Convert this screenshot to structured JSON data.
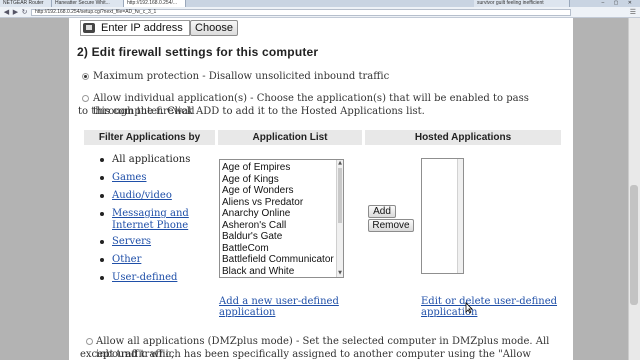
{
  "browser": {
    "tabs": [
      "NETGEAR Router",
      "Haneatter Secure Whit...",
      "http://192.168.0.254/...",
      "survivor guilt feeling inefficient"
    ],
    "window_controls": "– ▢ ✕",
    "url": "http://192.168.0.254/setup.cgi?next_file=AD_fw_c_3_1",
    "nav": {
      "back": "◀",
      "forward": "▶",
      "reload": "↻"
    },
    "menu_icon": "☰"
  },
  "ip": {
    "placeholder": "Enter IP address",
    "choose_label": "Choose"
  },
  "section": {
    "title": "2) Edit firewall settings for this computer",
    "opt_max": "Maximum protection - Disallow unsolicited inbound traffic",
    "opt_allow_line1": "Allow individual application(s) - Choose the application(s) that will be enabled to pass through the firewall",
    "opt_allow_line2": "to this computer. Click ADD to add it to the Hosted Applications list.",
    "opt_dmz_line1": "Allow all applications (DMZplus mode) - Set the selected computer in DMZplus mode. All inbound traffic,",
    "opt_dmz_line2": "except traffic which has been specifically assigned to another computer using the \"Allow individual"
  },
  "table": {
    "h_filter": "Filter Applications by",
    "h_apps": "Application List",
    "h_hosted": "Hosted Applications"
  },
  "filters": [
    {
      "label": "All applications",
      "link": false
    },
    {
      "label": "Games",
      "link": true
    },
    {
      "label": "Audio/video",
      "link": true
    },
    {
      "label": "Messaging and Internet Phone",
      "link": true
    },
    {
      "label": "Servers",
      "link": true
    },
    {
      "label": "Other",
      "link": true
    },
    {
      "label": "User-defined",
      "link": true
    }
  ],
  "apps": [
    "Age of Empires",
    "Age of Kings",
    "Age of Wonders",
    "Aliens vs Predator",
    "Anarchy Online",
    "Asheron's Call",
    "Baldur's Gate",
    "BattleCom",
    "Battlefield Communicator",
    "Black and White"
  ],
  "buttons": {
    "add": "Add",
    "remove": "Remove"
  },
  "links": {
    "add_user_defined": "Add a new user-defined application",
    "edit_user_defined": "Edit or delete user-defined application"
  }
}
